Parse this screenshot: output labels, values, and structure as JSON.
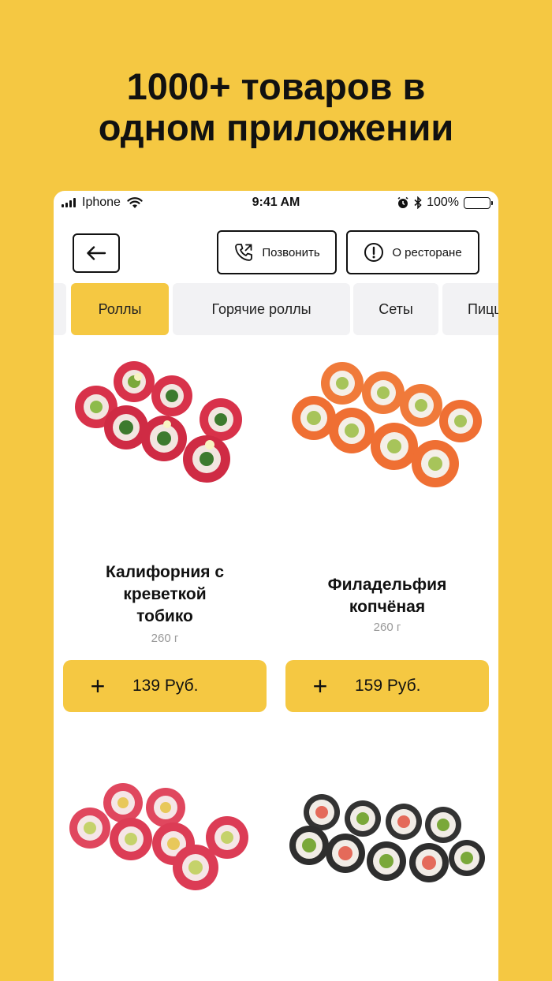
{
  "promo": {
    "line1": "1000+ товаров в",
    "line2": "одном приложении"
  },
  "status_bar": {
    "carrier": "Iphone",
    "time": "9:41 AM",
    "battery": "100%"
  },
  "header": {
    "call_label": "Позвонить",
    "about_label": "О ресторане"
  },
  "tabs": [
    "Роллы",
    "Горячие роллы",
    "Сеты",
    "Пицца"
  ],
  "active_tab": "Роллы",
  "products": [
    {
      "name_lines": [
        "Калифорния с",
        "креветкой",
        "тобико"
      ],
      "weight": "260 г",
      "price": "139 Руб.",
      "add_icon": "+"
    },
    {
      "name_lines": [
        "Филадельфия",
        "копчёная"
      ],
      "weight": "260 г",
      "price": "159 Руб.",
      "add_icon": "+"
    },
    {
      "name_lines": [],
      "weight": "",
      "price": ""
    },
    {
      "name_lines": [],
      "weight": "",
      "price": ""
    }
  ],
  "colors": {
    "brand_yellow": "#F5C842",
    "tab_bg": "#F2F2F4",
    "text": "#111111",
    "muted": "#999999"
  },
  "icons": [
    "cellular-signal-icon",
    "wifi-icon",
    "alarm-icon",
    "bluetooth-icon",
    "battery-icon",
    "arrow-left-icon",
    "phone-call-icon",
    "info-icon",
    "plus-icon"
  ]
}
